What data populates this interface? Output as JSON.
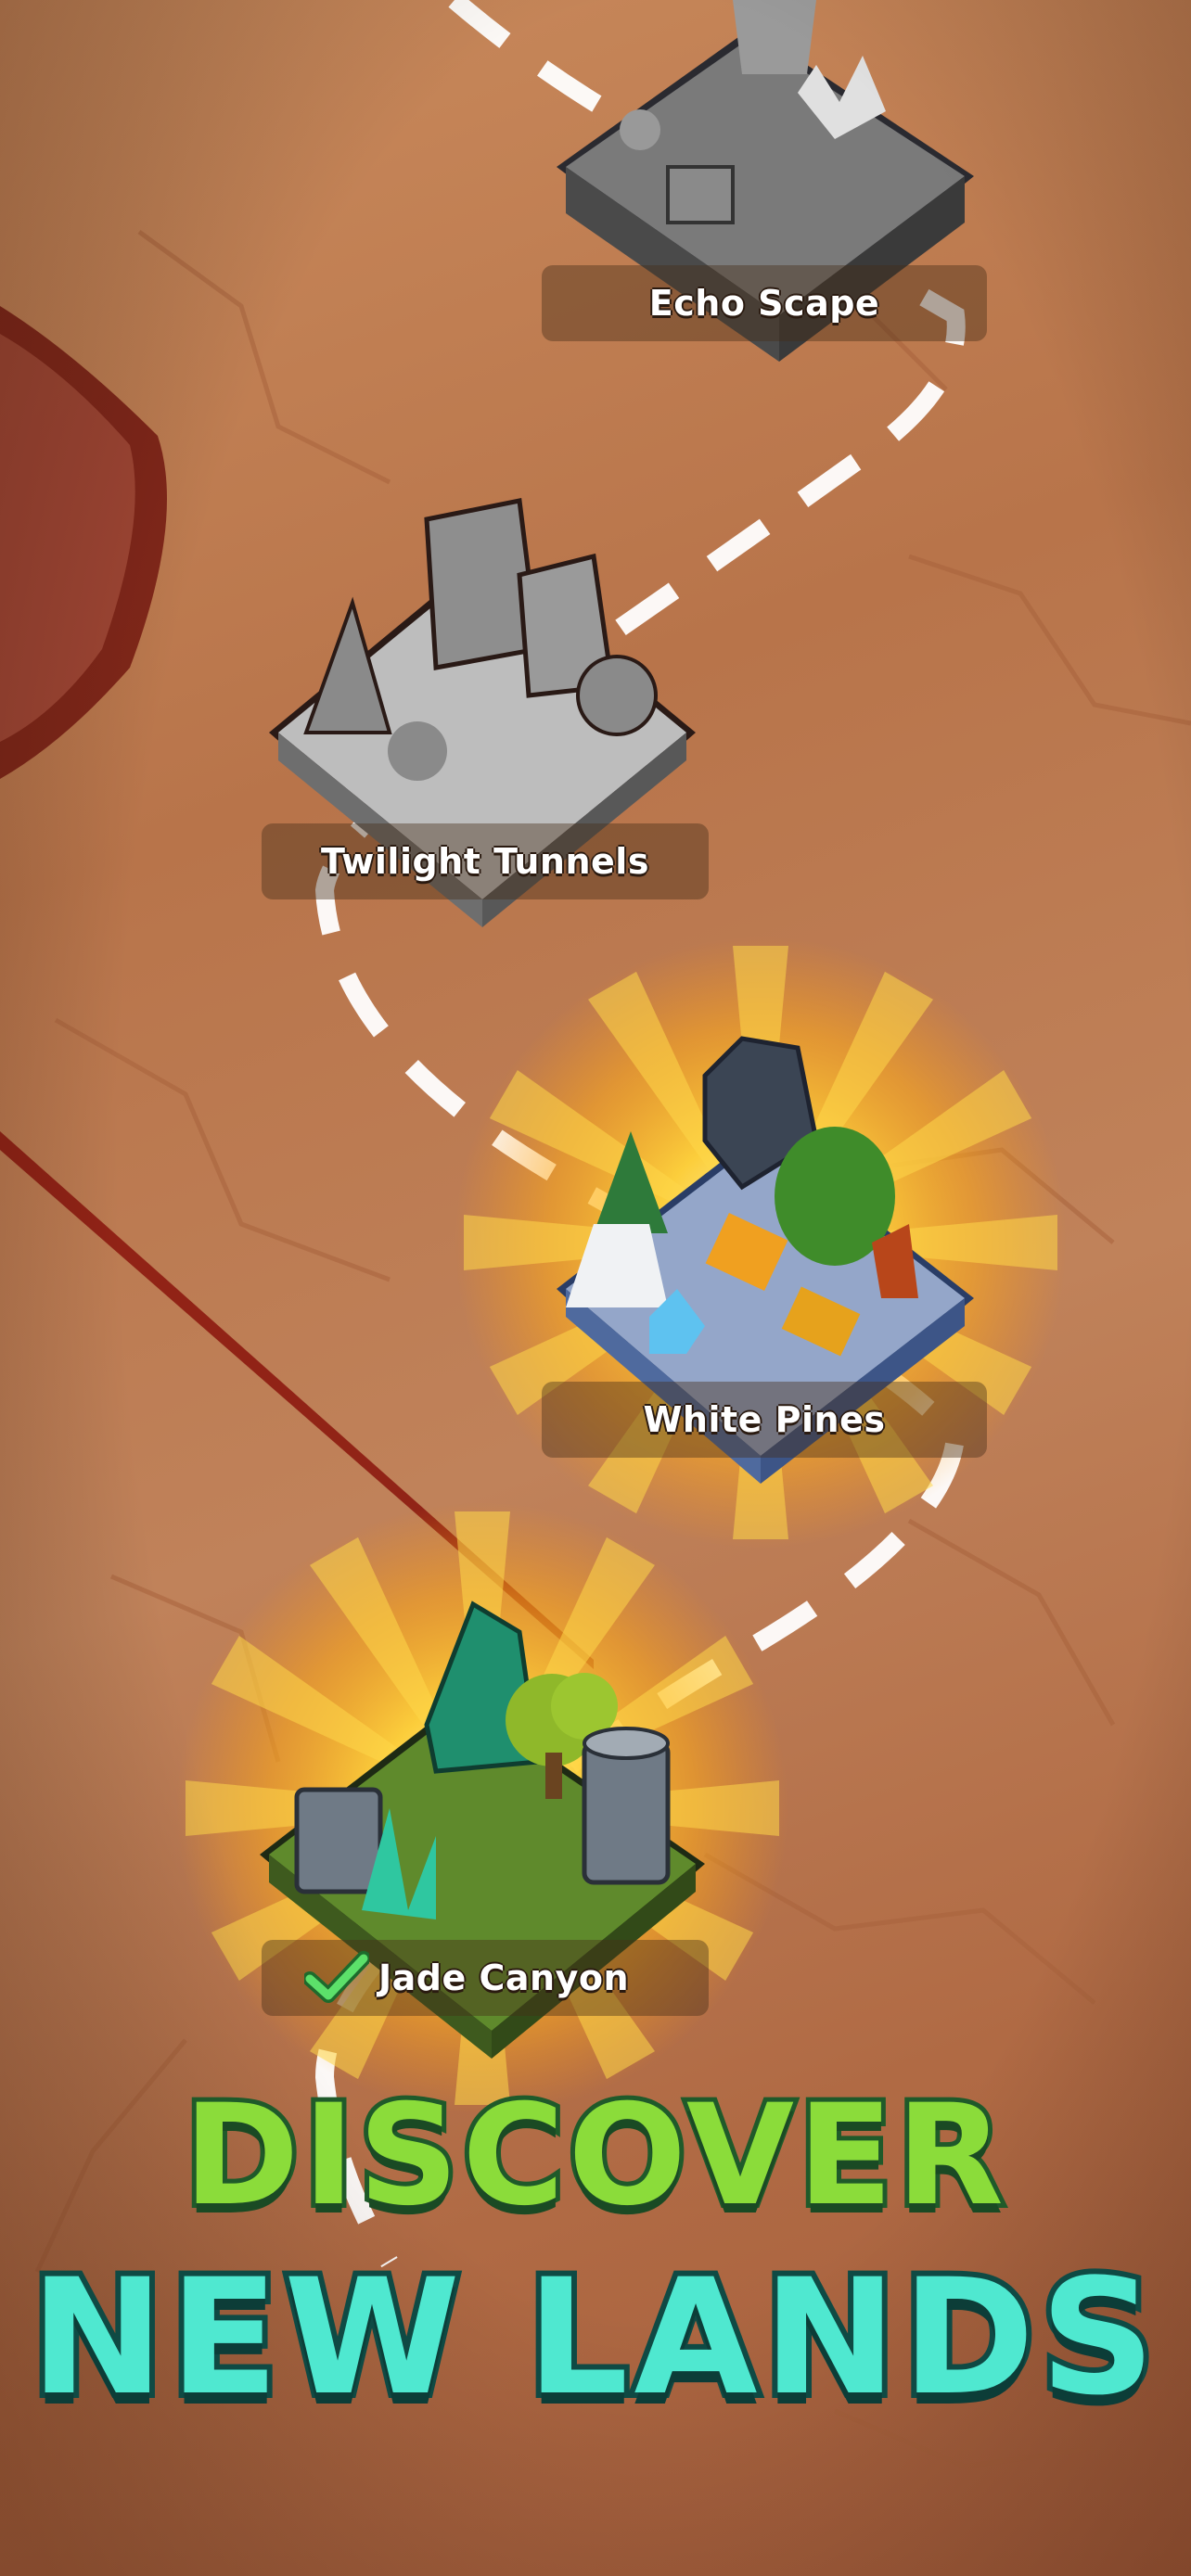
{
  "levels": [
    {
      "name": "Echo Scape",
      "state": "locked"
    },
    {
      "name": "Twilight Tunnels",
      "state": "locked"
    },
    {
      "name": "White Pines",
      "state": "unlocked"
    },
    {
      "name": "Jade Canyon",
      "state": "completed",
      "icon": "check-icon"
    }
  ],
  "headline": {
    "line1": "DISCOVER",
    "line2": "NEW LANDS"
  },
  "colors": {
    "background": "#c0825a",
    "headline_green": "#8bdc3a",
    "headline_teal": "#4fe8d0",
    "glow": "#ffc21a",
    "path": "#ffffff"
  }
}
